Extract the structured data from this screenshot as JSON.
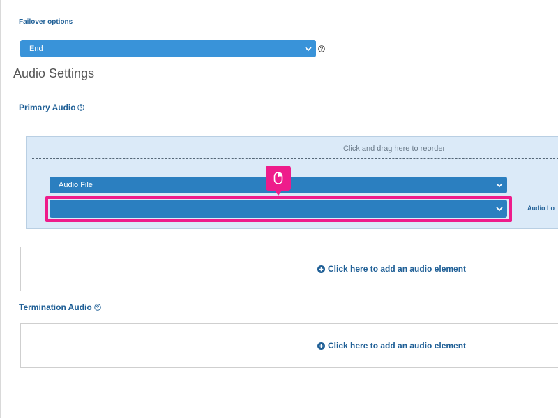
{
  "failover": {
    "label": "Failover options",
    "selected": "End"
  },
  "audio_settings": {
    "title": "Audio Settings",
    "primary_audio": {
      "heading": "Primary Audio",
      "drag_hint": "Click and drag here to reorder",
      "type_selected": "Audio File",
      "file_selected": "",
      "location_label": "Audio Lo"
    },
    "add_element_label": "Click here to add an audio element",
    "termination_audio": {
      "heading": "Termination Audio",
      "add_element_label": "Click here to add an audio element"
    }
  },
  "colors": {
    "select_bg": "#2b7fc0",
    "highlight": "#ee1c8b",
    "panel_bg": "#dbeaf8"
  },
  "icons": [
    "help-circle-icon",
    "chevron-down-icon",
    "plus-circle-icon",
    "mouse-icon"
  ]
}
